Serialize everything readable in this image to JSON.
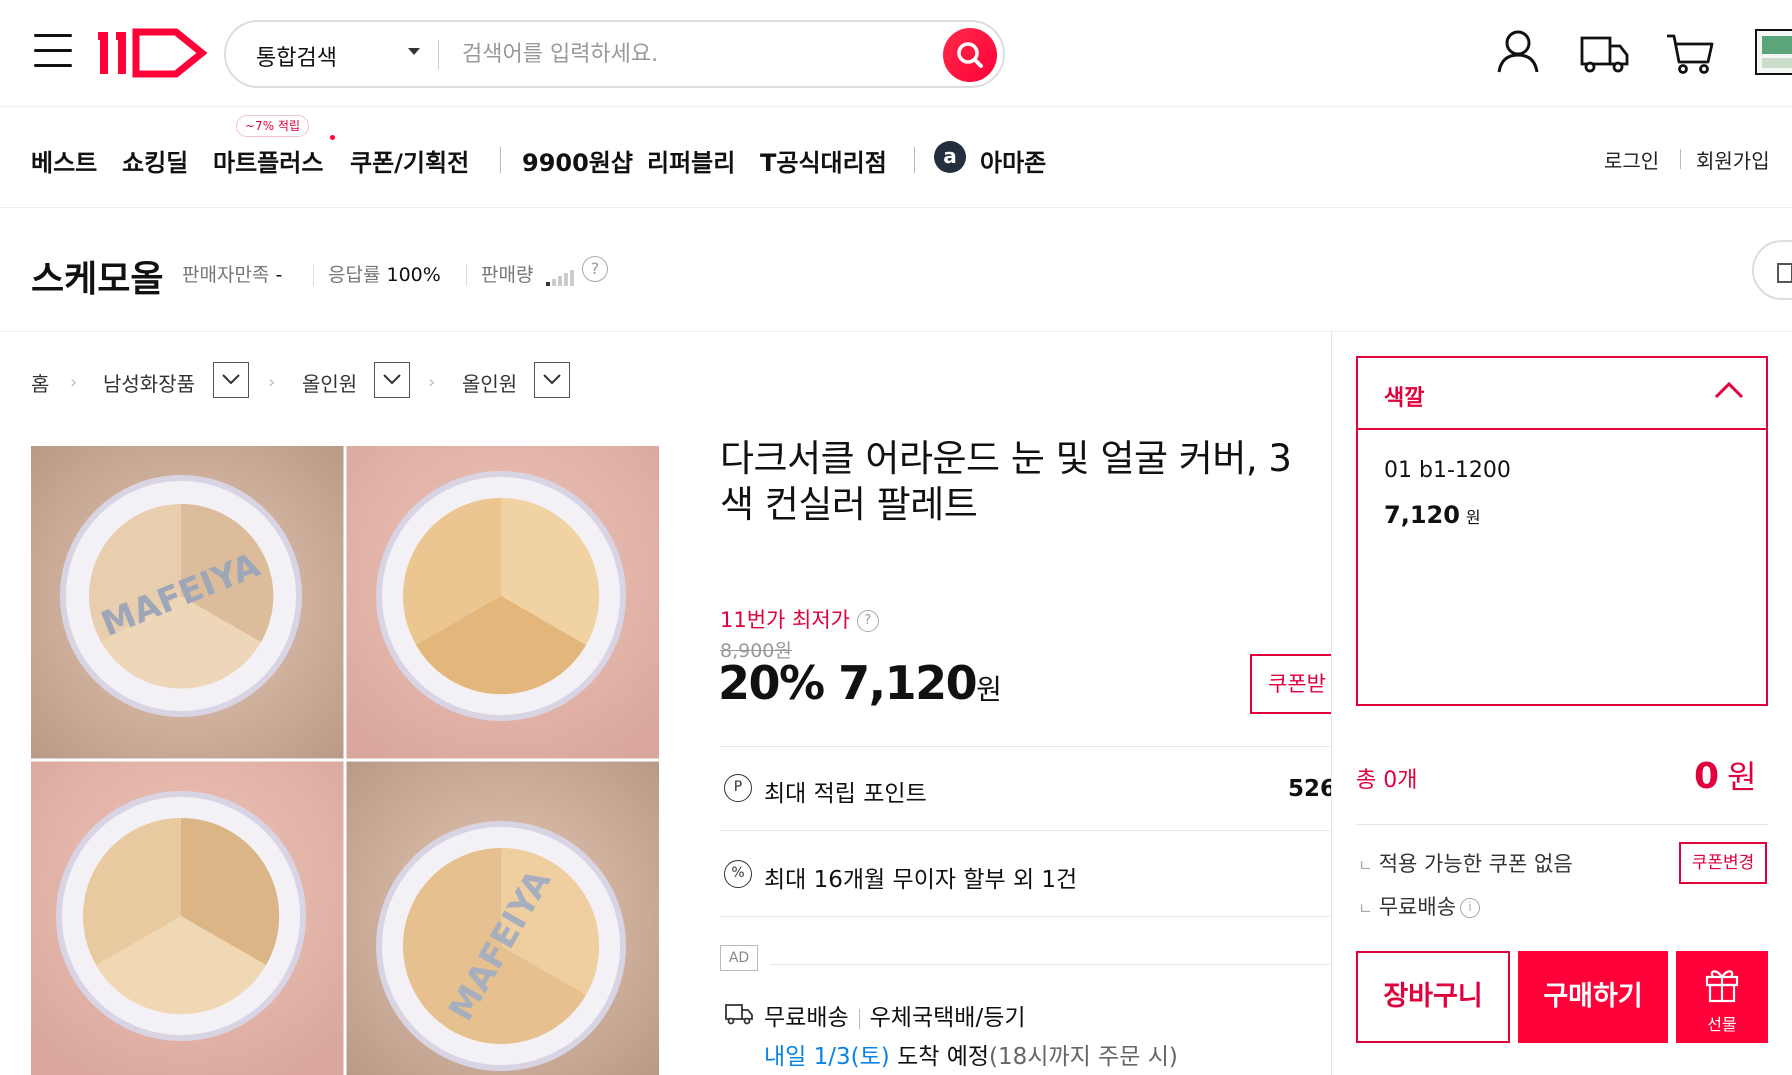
{
  "header": {
    "search_category": "통합검색",
    "search_placeholder": "검색어를 입력하세요."
  },
  "nav": {
    "items": [
      "베스트",
      "쇼킹딜",
      "마트플러스",
      "쿠폰/기획전",
      "9900원샵",
      "리퍼블리",
      "T공식대리점",
      "아마존"
    ],
    "badge": "~7% 적립",
    "amazon_glyph": "a",
    "login": "로그인",
    "signup": "회원가입"
  },
  "seller": {
    "name": "스케모올",
    "satisfaction_label": "판매자만족",
    "satisfaction_value": "-",
    "response_label": "응답률",
    "response_value": "100%",
    "sales_label": "판매량",
    "help": "?"
  },
  "breadcrumb": [
    "홈",
    "남성화장품",
    "올인원",
    "올인원"
  ],
  "product": {
    "title": "다크서클 어라운드 눈 및 얼굴 커버, 3색 컨실러 팔레트",
    "lowest_label": "11번가 최저가",
    "original_price": "8,900원",
    "discount": "20%",
    "sale_price": "7,120",
    "won": "원",
    "coupon_button": "쿠폰받",
    "points_label": "최대 적립 포인트",
    "points_value": "526",
    "points_icon": "P",
    "installment_label": "최대 16개월 무이자 할부 외 1건",
    "installment_icon": "%",
    "ad_tag": "AD",
    "shipping_free": "무료배송",
    "shipping_method": "우체국택배/등기",
    "arrival_date": "내일 1/3(토)",
    "arrival_text": " 도착 예정",
    "arrival_note": "(18시까지 주문 시)",
    "image_text": "MAFEIYA"
  },
  "order_panel": {
    "option_title": "색깔",
    "option_name": "01 b1-1200",
    "option_price": "7,120",
    "option_won": "원",
    "total_label": "총 0개",
    "total_value": "0",
    "total_won": "원",
    "coupon_none": "적용 가능한 쿠폰 없음",
    "coupon_change": "쿠폰변경",
    "free_shipping": "무료배송",
    "sub_prefix": "ㄴ",
    "info_i": "i",
    "cart_button": "장바구니",
    "buy_button": "구매하기",
    "gift_button": "선물"
  },
  "colors": {
    "accent": "#ff0038",
    "accent_text": "#e0003c",
    "link_blue": "#0b83e6"
  }
}
